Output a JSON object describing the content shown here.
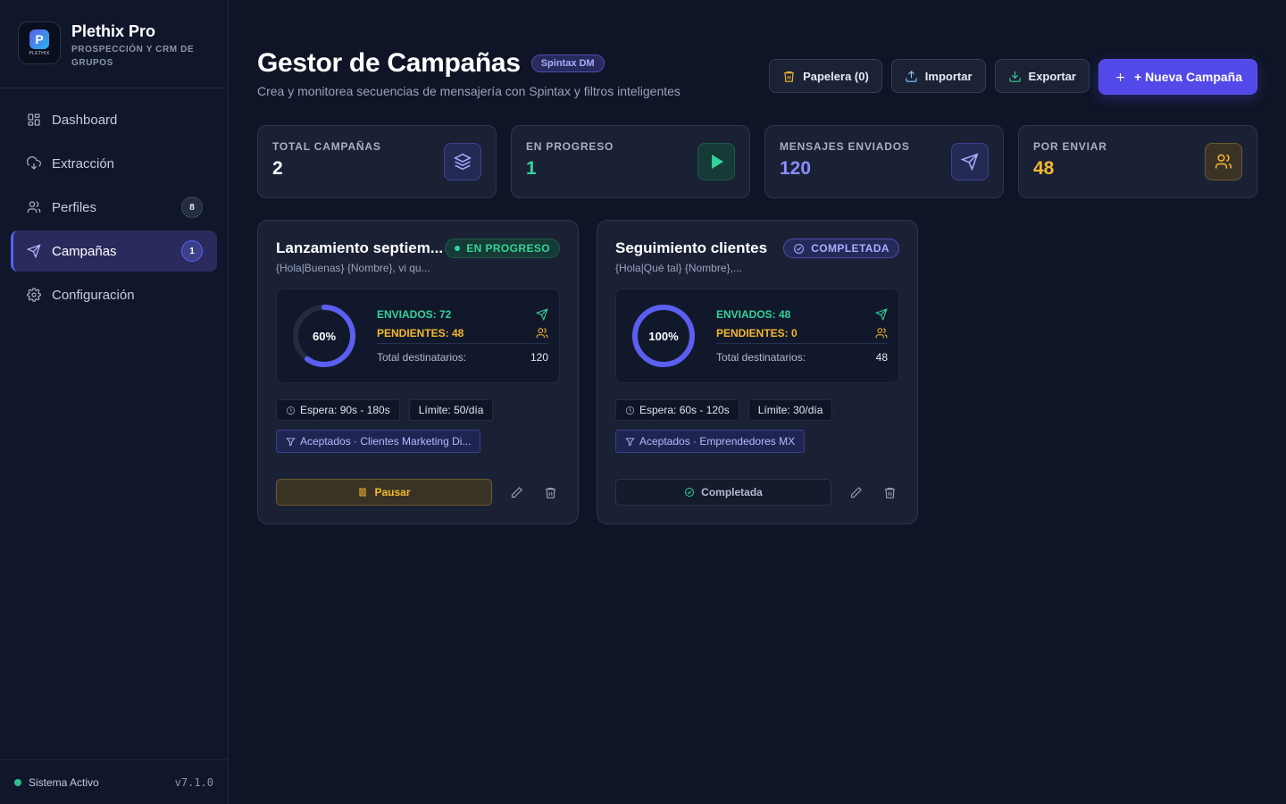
{
  "brand": {
    "name": "Plethix Pro",
    "tagline": "PROSPECCIÓN Y CRM DE GRUPOS",
    "logo_text": "PLETHIX"
  },
  "nav": {
    "items": [
      {
        "label": "Dashboard",
        "icon": "grid-icon"
      },
      {
        "label": "Extracción",
        "icon": "cloud-download-icon"
      },
      {
        "label": "Perfiles",
        "icon": "users-icon",
        "badge": "8"
      },
      {
        "label": "Campañas",
        "icon": "send-icon",
        "badge": "1",
        "active": true
      },
      {
        "label": "Configuración",
        "icon": "gear-icon"
      }
    ]
  },
  "system": {
    "status": "Sistema Activo",
    "version": "v7.1.0"
  },
  "header": {
    "title": "Gestor de Campañas",
    "badge": "Spintax DM",
    "subtitle": "Crea y monitorea secuencias de mensajería con Spintax y filtros inteligentes"
  },
  "actions": {
    "trash": "Papelera (0)",
    "import": "Importar",
    "export": "Exportar",
    "new": "+ Nueva Campaña"
  },
  "stats": [
    {
      "label": "TOTAL CAMPAÑAS",
      "value": "2",
      "icon": "layers-icon",
      "color": "#ffffff"
    },
    {
      "label": "EN PROGRESO",
      "value": "1",
      "icon": "play-icon",
      "color": "#34d399"
    },
    {
      "label": "MENSAJES ENVIADOS",
      "value": "120",
      "icon": "send-icon",
      "color": "#8b8dff"
    },
    {
      "label": "POR ENVIAR",
      "value": "48",
      "icon": "users-icon",
      "color": "#f5b82e"
    }
  ],
  "campaigns": [
    {
      "title": "Lanzamiento septiem...",
      "status": "EN PROGRESO",
      "message": "{Hola|Buenas} {Nombre}, vi qu...",
      "percent_label": "60%",
      "progress": 0.6,
      "sent": "ENVIADOS: 72",
      "pending": "PENDIENTES: 48",
      "total_label": "Total destinatarios:",
      "total": "120",
      "wait": "Espera: 90s - 180s",
      "limit": "Límite: 50/día",
      "filter": "Aceptados · Clientes Marketing Di...",
      "action": "Pausar"
    },
    {
      "title": "Seguimiento clientes",
      "status": "COMPLETADA",
      "message": "{Hola|Qué tal} {Nombre},...",
      "percent_label": "100%",
      "progress": 1.0,
      "sent": "ENVIADOS: 48",
      "pending": "PENDIENTES: 0",
      "total_label": "Total destinatarios:",
      "total": "48",
      "wait": "Espera: 60s - 120s",
      "limit": "Límite: 30/día",
      "filter": "Aceptados · Emprendedores MX",
      "action": "Completada"
    }
  ],
  "colors": {
    "accent": "#5249e8",
    "success": "#34d399",
    "warning": "#f5b82e",
    "background": "#0f1526"
  }
}
